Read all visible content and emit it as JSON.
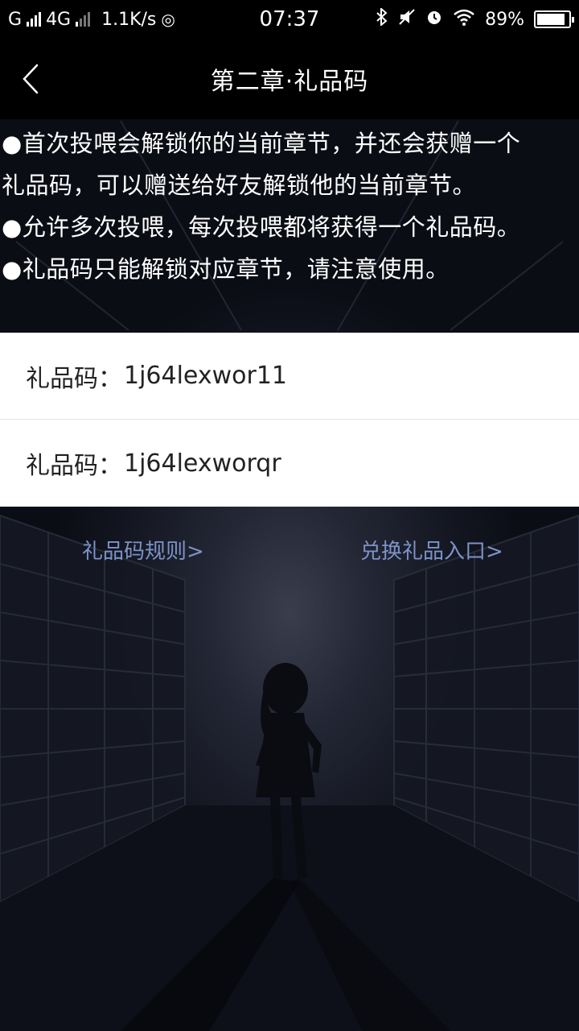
{
  "status_bar": {
    "carrier_signal": "G",
    "network": "4G",
    "speed": "1.1K/s",
    "time": "07:37",
    "battery": "89%",
    "battery_level": 0.89
  },
  "nav": {
    "title": "第二章·礼品码"
  },
  "info": {
    "lines": [
      "●首次投喂会解锁你的当前章节，并还会获赠一个",
      "礼品码，可以赠送给好友解锁他的当前章节。",
      "●允许多次投喂，每次投喂都将获得一个礼品码。",
      "●礼品码只能解锁对应章节，请注意使用。"
    ]
  },
  "codes": [
    {
      "label": "礼品码：",
      "value": "1j64lexwor11"
    },
    {
      "label": "礼品码：",
      "value": "1j64lexworqr"
    }
  ],
  "links": {
    "rules": "礼品码规则>",
    "redeem": "兑换礼品入口>"
  },
  "colors": {
    "link": "#7c93c8",
    "bar": "#000000"
  }
}
